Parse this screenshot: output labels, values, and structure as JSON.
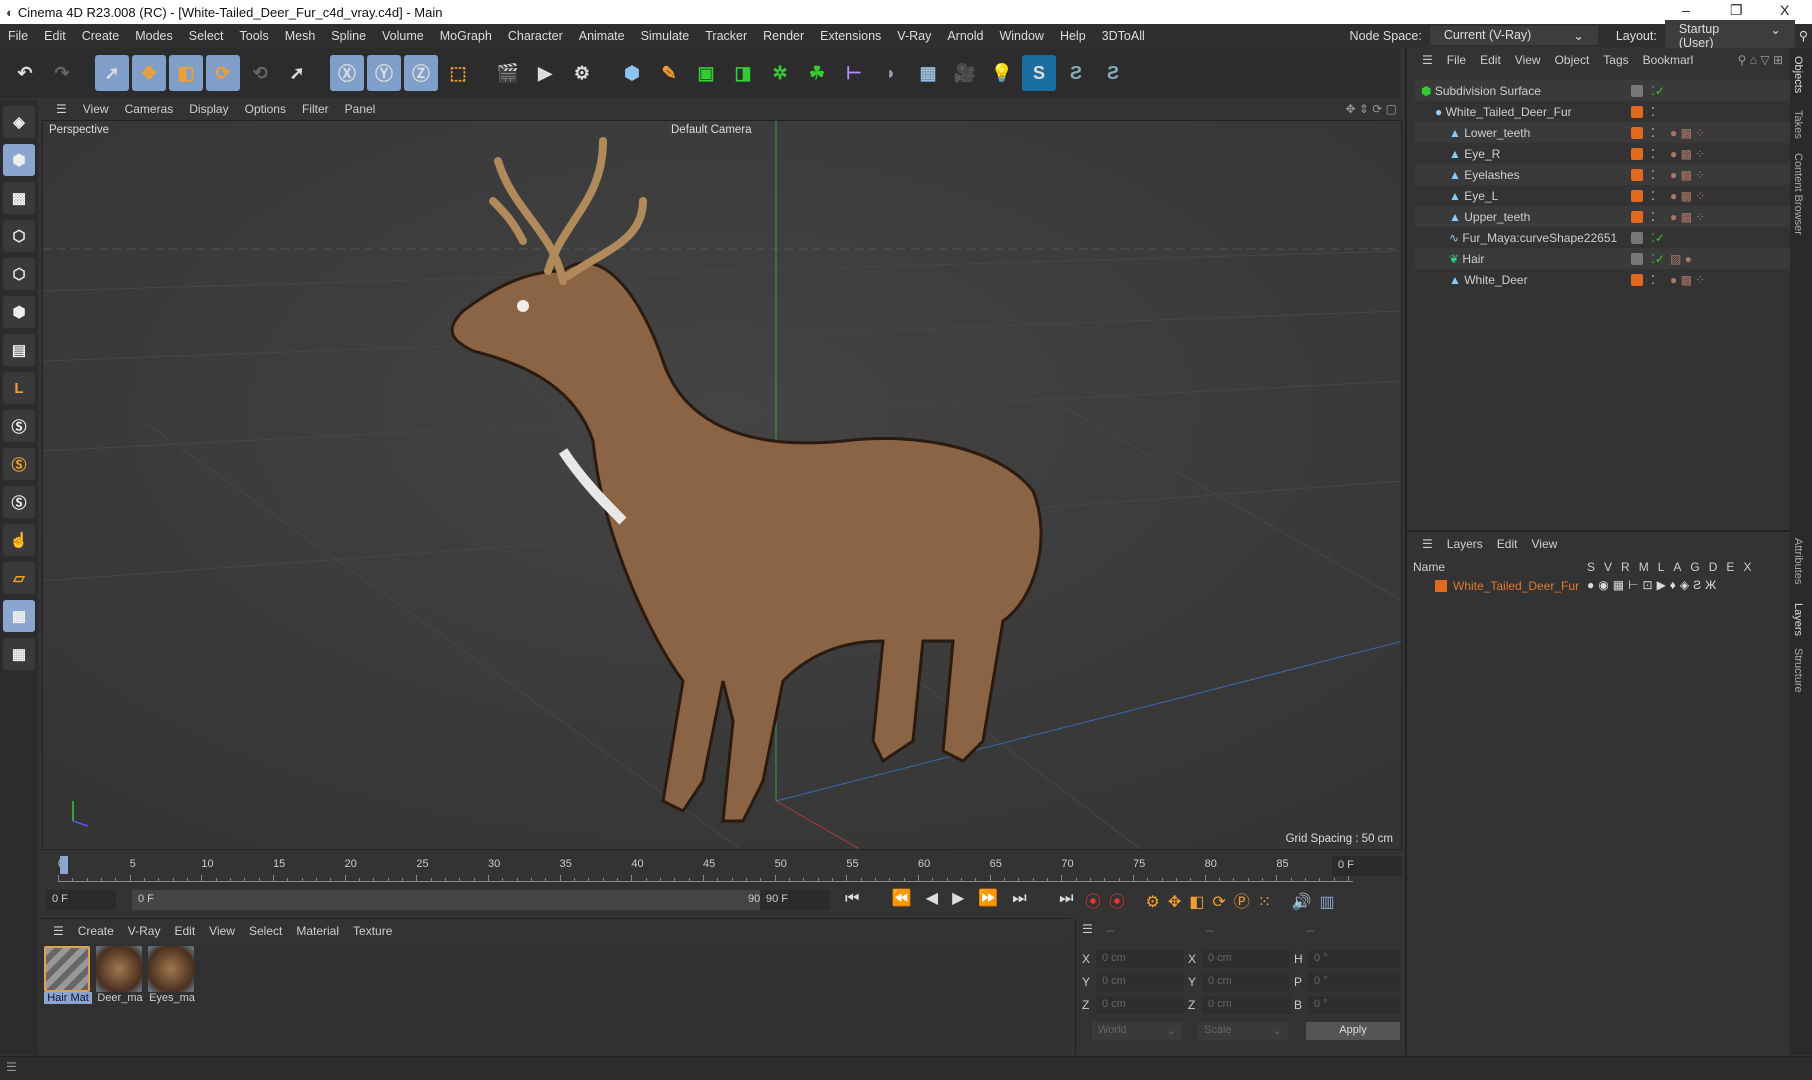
{
  "window": {
    "title": "Cinema 4D R23.008 (RC) - [White-Tailed_Deer_Fur_c4d_vray.c4d] - Main",
    "minimize": "–",
    "restore": "❐",
    "close": "X"
  },
  "menu": [
    "File",
    "Edit",
    "Create",
    "Modes",
    "Select",
    "Tools",
    "Mesh",
    "Spline",
    "Volume",
    "MoGraph",
    "Character",
    "Animate",
    "Simulate",
    "Tracker",
    "Render",
    "Extensions",
    "V-Ray",
    "Arnold",
    "Window",
    "Help",
    "3DToAll"
  ],
  "node_space": {
    "label": "Node Space:",
    "value": "Current (V-Ray)"
  },
  "layout": {
    "label": "Layout:",
    "value": "Startup (User)"
  },
  "viewport": {
    "menu": [
      "View",
      "Cameras",
      "Display",
      "Options",
      "Filter",
      "Panel"
    ],
    "projection": "Perspective",
    "camera": "Default Camera",
    "grid_spacing": "Grid Spacing : 50 cm"
  },
  "objects": {
    "menu": [
      "File",
      "Edit",
      "View",
      "Object",
      "Tags",
      "Bookmarl"
    ],
    "items": [
      {
        "name": "Subdivision Surface",
        "depth": 0,
        "type": "generator"
      },
      {
        "name": "White_Tailed_Deer_Fur",
        "depth": 1,
        "type": "null"
      },
      {
        "name": "Lower_teeth",
        "depth": 2,
        "type": "mesh"
      },
      {
        "name": "Eye_R",
        "depth": 2,
        "type": "mesh"
      },
      {
        "name": "Eyelashes",
        "depth": 2,
        "type": "mesh"
      },
      {
        "name": "Eye_L",
        "depth": 2,
        "type": "mesh"
      },
      {
        "name": "Upper_teeth",
        "depth": 2,
        "type": "mesh"
      },
      {
        "name": "Fur_Maya:curveShape22651",
        "depth": 2,
        "type": "spline"
      },
      {
        "name": "Hair",
        "depth": 2,
        "type": "hair"
      },
      {
        "name": "White_Deer",
        "depth": 2,
        "type": "mesh"
      }
    ]
  },
  "side_tabs": [
    "Objects",
    "Takes",
    "Content Browser",
    "Attributes",
    "Layers",
    "Structure"
  ],
  "layers": {
    "menu": [
      "Layers",
      "Edit",
      "View"
    ],
    "name_header": "Name",
    "columns": [
      "S",
      "V",
      "R",
      "M",
      "L",
      "A",
      "G",
      "D",
      "E",
      "X"
    ],
    "items": [
      {
        "name": "White_Tailed_Deer_Fur",
        "color": "#e06a20"
      }
    ]
  },
  "timeline": {
    "ticks": [
      "0",
      "5",
      "10",
      "15",
      "20",
      "25",
      "30",
      "35",
      "40",
      "45",
      "50",
      "55",
      "60",
      "65",
      "70",
      "75",
      "80",
      "85",
      "90"
    ],
    "current_frame": "0 F",
    "start": "0 F",
    "range_start": "0 F",
    "range_end": "90 F",
    "end": "90 F"
  },
  "materials": {
    "menu": [
      "Create",
      "V-Ray",
      "Edit",
      "View",
      "Select",
      "Material",
      "Texture"
    ],
    "items": [
      "Hair Mat",
      "Deer_ma",
      "Eyes_ma"
    ]
  },
  "coords": {
    "headers": [
      "--",
      "--",
      "--"
    ],
    "pos": {
      "X": "0 cm",
      "Y": "0 cm",
      "Z": "0 cm"
    },
    "size": {
      "X": "0 cm",
      "Y": "0 cm",
      "Z": "0 cm"
    },
    "rot": {
      "H": "0 °",
      "P": "0 °",
      "B": "0 °"
    },
    "space": "World",
    "mode": "Scale",
    "apply": "Apply"
  },
  "colors": {
    "accent": "#8aa6cf",
    "orange": "#e06a20",
    "bg": "#333333"
  }
}
